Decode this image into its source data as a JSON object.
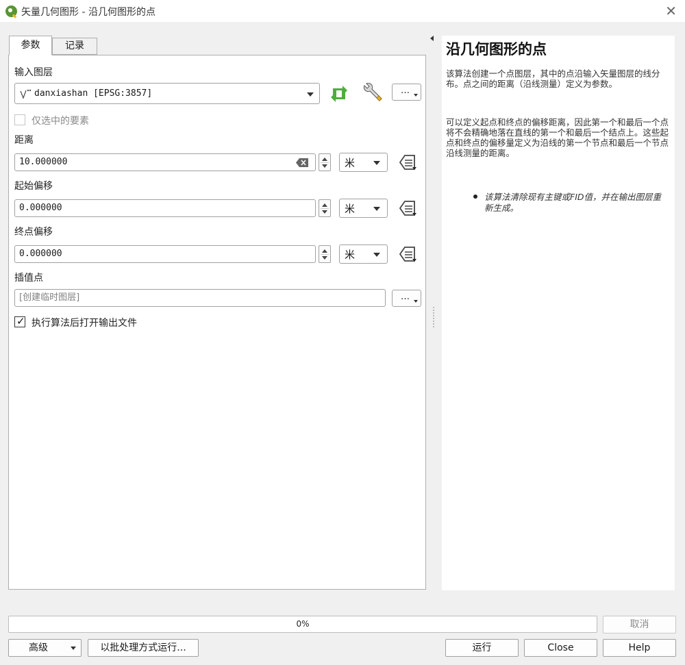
{
  "window": {
    "title": "矢量几何图形 - 沿几何图形的点",
    "app_icon": "qgis-icon",
    "close_icon": "close-icon"
  },
  "tabs": [
    {
      "label": "参数",
      "active": true
    },
    {
      "label": "记录",
      "active": false
    }
  ],
  "params": {
    "input_layer": {
      "label": "输入图层",
      "value": "danxiashan [EPSG:3857]",
      "layer_icon": "line-layer-icon"
    },
    "selected_only": {
      "label": "仅选中的要素",
      "checked": false,
      "enabled": false
    },
    "distance": {
      "label": "距离",
      "value": "10.000000",
      "unit": "米"
    },
    "start_offset": {
      "label": "起始偏移",
      "value": "0.000000",
      "unit": "米"
    },
    "end_offset": {
      "label": "终点偏移",
      "value": "0.000000",
      "unit": "米"
    },
    "output": {
      "label": "插值点",
      "placeholder": "[创建临时图层]"
    },
    "open_output": {
      "label": "执行算法后打开输出文件",
      "checked": true
    },
    "dots_label": "…"
  },
  "help": {
    "title": "沿几何图形的点",
    "para1": "该算法创建一个点图层，其中的点沿输入矢量图层的线分布。点之间的距离（沿线测量）定义为参数。",
    "para2": "可以定义起点和终点的偏移距离，因此第一个和最后一个点将不会精确地落在直线的第一个和最后一个结点上。这些起点和终点的偏移量定义为沿线的第一个节点和最后一个节点沿线测量的距离。",
    "note": "该算法清除现有主键或FID值，并在输出图层重新生成。"
  },
  "footer": {
    "progress_text": "0%",
    "progress_value": 0,
    "cancel_label": "取消",
    "advanced_label": "高级",
    "batch_label": "以批处理方式运行...",
    "run_label": "运行",
    "close_label": "Close",
    "help_label": "Help"
  }
}
